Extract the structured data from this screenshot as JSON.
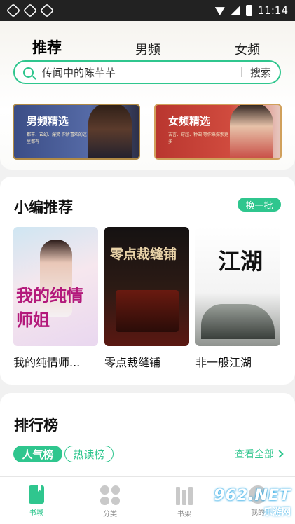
{
  "status_bar": {
    "time": "11:14"
  },
  "header": {
    "tabs": [
      {
        "label": "推荐",
        "active": true
      },
      {
        "label": "男频",
        "active": false
      },
      {
        "label": "女频",
        "active": false
      }
    ],
    "search": {
      "query": "传闻中的陈芊芊",
      "button": "搜索"
    },
    "banners": [
      {
        "title": "男频精选",
        "subtitle": "都市、玄幻、爆笑 你所喜欢的这里都有"
      },
      {
        "title": "女频精选",
        "subtitle": "古言、穿越、种田 等你来探索更多"
      }
    ]
  },
  "editor_picks": {
    "title": "小编推荐",
    "refresh_label": "换一批",
    "books": [
      {
        "title": "我的纯情师...",
        "cover_text": "我的纯情师姐"
      },
      {
        "title": "零点裁缝铺",
        "cover_text": "零点裁缝铺"
      },
      {
        "title": "非一般江湖",
        "cover_text": "江湖"
      }
    ]
  },
  "ranking": {
    "title": "排行榜",
    "tabs": [
      {
        "label": "人气榜",
        "active": true
      },
      {
        "label": "热读榜",
        "active": false
      }
    ],
    "view_all": "查看全部"
  },
  "bottom_nav": [
    {
      "label": "书城",
      "icon": "book-icon",
      "active": true
    },
    {
      "label": "分类",
      "icon": "category-icon",
      "active": false
    },
    {
      "label": "书架",
      "icon": "bookshelf-icon",
      "active": false
    },
    {
      "label": "我的",
      "icon": "profile-icon",
      "active": false
    }
  ],
  "watermark": {
    "main": "962.NET",
    "sub": "乐游网"
  },
  "colors": {
    "accent": "#2fc68e",
    "background": "#f1f1f1"
  }
}
